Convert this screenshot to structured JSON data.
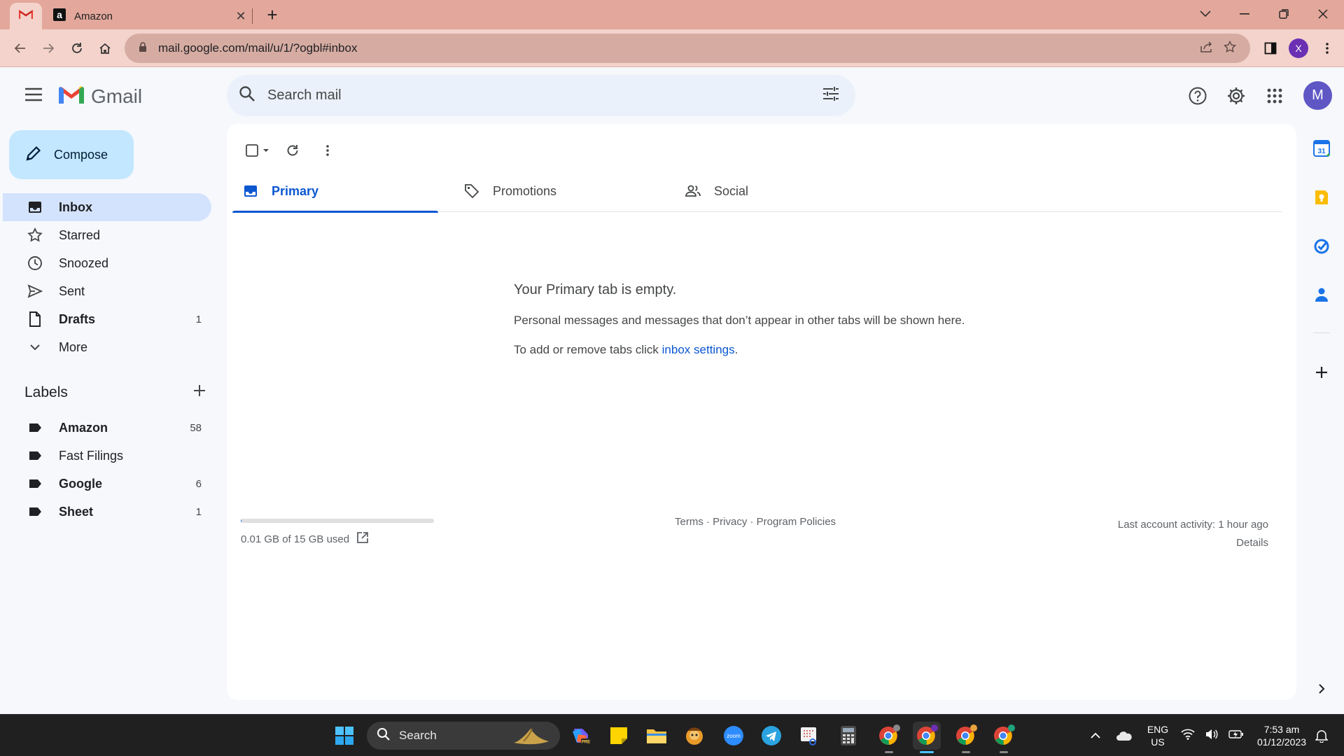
{
  "browser": {
    "tab_title": "Amazon",
    "url": "mail.google.com/mail/u/1/?ogbl#inbox",
    "profile_initial": "X"
  },
  "gmail": {
    "wordmark": "Gmail",
    "search_placeholder": "Search mail",
    "account_initial": "M",
    "compose_label": "Compose",
    "nav": [
      {
        "label": "Inbox",
        "count": ""
      },
      {
        "label": "Starred",
        "count": ""
      },
      {
        "label": "Snoozed",
        "count": ""
      },
      {
        "label": "Sent",
        "count": ""
      },
      {
        "label": "Drafts",
        "count": "1"
      },
      {
        "label": "More",
        "count": ""
      }
    ],
    "labels_title": "Labels",
    "labels": [
      {
        "label": "Amazon",
        "count": "58"
      },
      {
        "label": "Fast Filings",
        "count": ""
      },
      {
        "label": "Google",
        "count": "6"
      },
      {
        "label": "Sheet",
        "count": "1"
      }
    ],
    "tabs": [
      {
        "label": "Primary"
      },
      {
        "label": "Promotions"
      },
      {
        "label": "Social"
      }
    ],
    "empty": {
      "title": "Your Primary tab is empty.",
      "description": "Personal messages and messages that don’t appear in other tabs will be shown here.",
      "settings_prefix": "To add or remove tabs click ",
      "settings_link": "inbox settings",
      "settings_suffix": "."
    },
    "footer": {
      "storage_used": "0.01 GB of 15 GB used",
      "storage_fraction": 0.001,
      "links": "Terms · Privacy · Program Policies",
      "last_activity": "Last account activity: 1 hour ago",
      "details": "Details"
    }
  },
  "taskbar": {
    "search_label": "Search",
    "language": "ENG",
    "region": "US",
    "time": "7:53 am",
    "date": "01/12/2023"
  },
  "colors": {
    "tabstrip": "#e3a89b",
    "toolbar": "#f3d3cb",
    "gmail_bg": "#f6f8fc",
    "compose": "#c2e7ff",
    "active_nav": "#d3e3fd",
    "accent_blue": "#0b57d0",
    "avatar": "#5f57c4"
  }
}
